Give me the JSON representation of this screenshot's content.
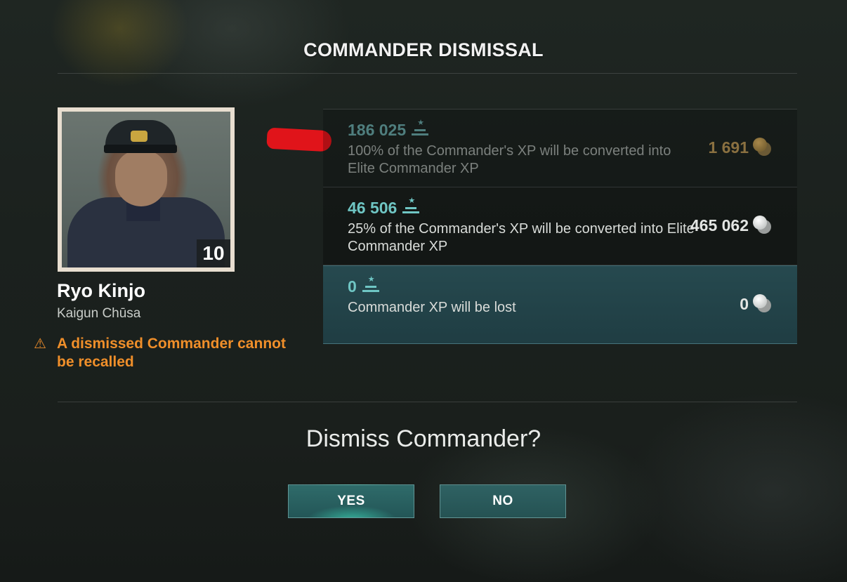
{
  "dialog": {
    "title": "COMMANDER DISMISSAL"
  },
  "commander": {
    "name": "Ryo Kinjo",
    "rank": "Kaigun Chūsa",
    "level": "10",
    "warning": "A dismissed Commander cannot be recalled"
  },
  "options": [
    {
      "xp": "186 025",
      "description": "100% of the Commander's XP will be converted into Elite Commander XP",
      "cost": "1 691",
      "currency": "gold",
      "state": "disabled"
    },
    {
      "xp": "46 506",
      "description": "25% of the Commander's XP will be converted into Elite Commander XP",
      "cost": "465 062",
      "currency": "credits",
      "state": "available"
    },
    {
      "xp": "0",
      "description": "Commander XP will be lost",
      "cost": "0",
      "currency": "credits",
      "state": "selected"
    }
  ],
  "confirm": {
    "question": "Dismiss Commander?",
    "yes_label": "YES",
    "no_label": "NO"
  },
  "colors": {
    "accent_teal": "#6fc6c4",
    "warning_orange": "#f08f2a",
    "annotation_red": "#e0141a"
  },
  "icons": {
    "xp": "elite-xp-icon",
    "credits": "credits-icon",
    "gold": "gold-icon",
    "warning": "warning-triangle-icon"
  }
}
